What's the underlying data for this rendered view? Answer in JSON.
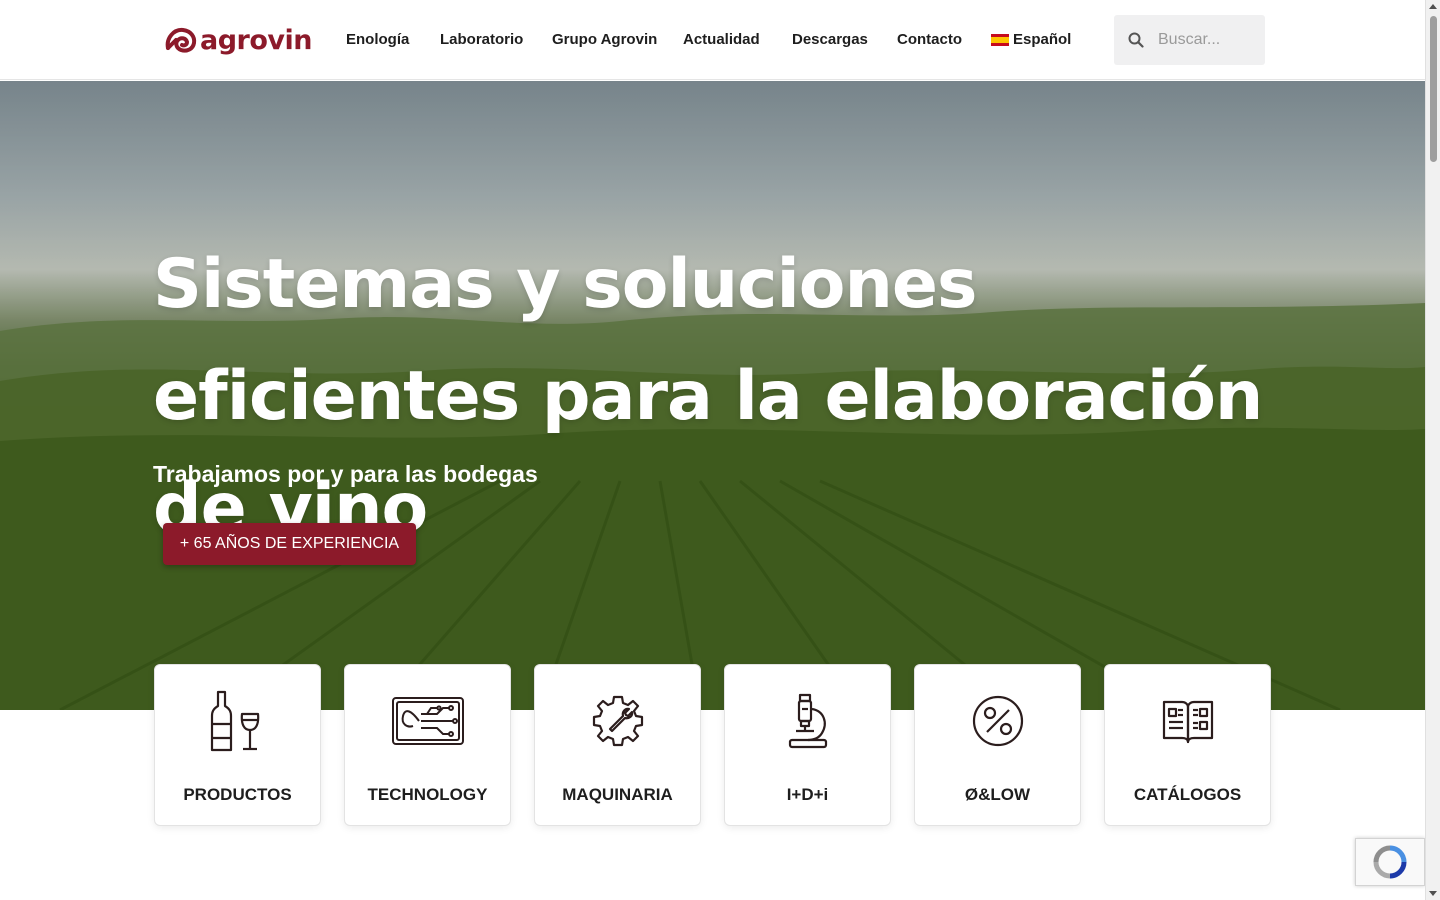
{
  "brand": {
    "name": "agrovin",
    "color": "#8c1a2a"
  },
  "nav": {
    "items": [
      {
        "label": "Enología"
      },
      {
        "label": "Laboratorio"
      },
      {
        "label": "Grupo Agrovin"
      },
      {
        "label": "Actualidad"
      },
      {
        "label": "Descargas"
      },
      {
        "label": "Contacto"
      }
    ],
    "language": {
      "label": "Español",
      "icon": "spain-flag-icon"
    }
  },
  "search": {
    "placeholder": "Buscar...",
    "icon": "search-icon"
  },
  "hero": {
    "title": "Sistemas y soluciones eficientes para la elaboración de vino",
    "subtitle": "Trabajamos por y para las bodegas",
    "cta": "+ 65 AÑOS DE EXPERIENCIA"
  },
  "categories": [
    {
      "label": "PRODUCTOS",
      "icon": "wine-bottle-glass-icon"
    },
    {
      "label": "TECHNOLOGY",
      "icon": "circuit-icon"
    },
    {
      "label": "MAQUINARIA",
      "icon": "gear-wrench-icon"
    },
    {
      "label": "I+D+i",
      "icon": "microscope-icon"
    },
    {
      "label": "Ø&LOW",
      "icon": "percent-icon"
    },
    {
      "label": "CATÁLOGOS",
      "icon": "catalog-book-icon"
    }
  ],
  "widgets": {
    "recaptcha_icon": "recaptcha-icon"
  }
}
